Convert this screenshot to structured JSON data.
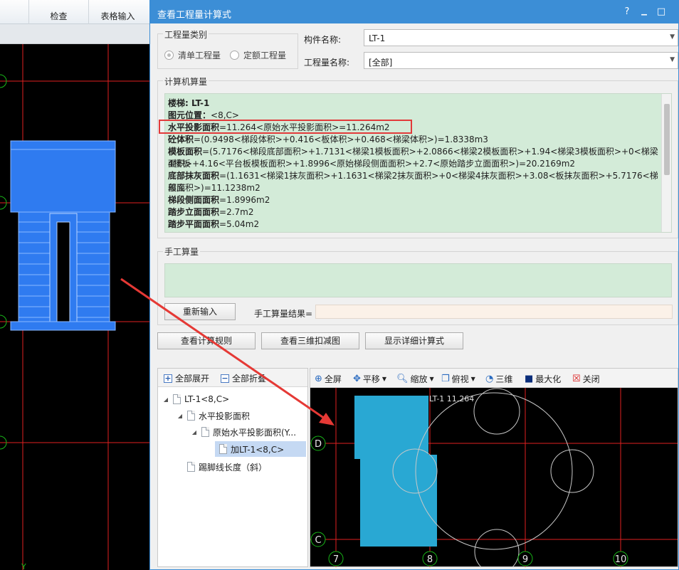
{
  "app": {
    "toolbar": [
      {
        "label": "检查"
      },
      {
        "label": "表格输入"
      }
    ],
    "axis_label_bottom": "Y"
  },
  "dialog": {
    "title": "查看工程量计算式",
    "controls": {
      "help": "?",
      "minimize": "▁",
      "maximize": "□"
    },
    "category": {
      "legend": "工程量类别",
      "options": [
        {
          "label": "清单工程量",
          "selected": true
        },
        {
          "label": "定额工程量",
          "selected": false
        }
      ]
    },
    "component": {
      "label": "构件名称:",
      "value": "LT-1"
    },
    "quantity_name": {
      "label": "工程量名称:",
      "value": "[全部]"
    },
    "computed": {
      "legend": "计算机算量",
      "lines": [
        {
          "name": "楼梯: LT-1",
          "rest": ""
        },
        {
          "name": "图元位置：",
          "rest": "<8,C>"
        },
        {
          "name": "水平投影面积",
          "rest": "=11.264<原始水平投影面积>=11.264m2"
        },
        {
          "name": "砼体积",
          "rest": "=(0.9498<梯段体积>+0.416<板体积>+0.468<梯梁体积>)=1.8338m3"
        },
        {
          "name": "模板面积",
          "rest": "=(5.7176<梯段底部面积>+1.7131<梯梁1模板面积>+2.0866<梯梁2模板面积>+1.94<梯梁3模板面积>+0<梯梁4模板"
        },
        {
          "name": "",
          "rest": "面积>+4.16<平台板模板面积>+1.8996<原始梯段侧面面积>+2.7<原始踏步立面面积>)=20.2169m2"
        },
        {
          "name": "底部抹灰面积",
          "rest": "=(1.1631<梯梁1抹灰面积>+1.1631<梯梁2抹灰面积>+0<梯梁4抹灰面积>+3.08<板抹灰面积>+5.7176<梯段底"
        },
        {
          "name": "",
          "rest": "部面积>)=11.1238m2"
        },
        {
          "name": "梯段侧面面积",
          "rest": "=1.8996m2"
        },
        {
          "name": "踏步立面面积",
          "rest": "=2.7m2"
        },
        {
          "name": "踏步平面面积",
          "rest": "=5.04m2"
        }
      ]
    },
    "manual": {
      "legend": "手工算量",
      "reenter_button": "重新输入",
      "result_label": "手工算量结果=",
      "result_value": ""
    },
    "actions": [
      {
        "label": "查看计算规则"
      },
      {
        "label": "查看三维扣减图"
      },
      {
        "label": "显示详细计算式"
      }
    ],
    "tree": {
      "toolbar": [
        {
          "label": "全部展开",
          "icon": "plus-square-icon"
        },
        {
          "label": "全部折叠",
          "icon": "minus-square-icon"
        }
      ],
      "nodes": [
        {
          "label": "LT-1<8,C>",
          "level": 0,
          "expanded": true
        },
        {
          "label": "水平投影面积",
          "level": 1,
          "expanded": true
        },
        {
          "label": "原始水平投影面积(Y...",
          "level": 2,
          "expanded": true
        },
        {
          "label": "加LT-1<8,C>",
          "level": 3,
          "selected": true
        },
        {
          "label": "踢脚线长度（斜）",
          "level": 1
        }
      ]
    },
    "view": {
      "toolbar": [
        {
          "label": "全屏",
          "icon": "fullscreen-icon"
        },
        {
          "label": "平移",
          "icon": "pan-icon",
          "dropdown": true
        },
        {
          "label": "缩放",
          "icon": "zoom-icon",
          "dropdown": true
        },
        {
          "label": "俯视",
          "icon": "top-view-icon",
          "dropdown": true
        },
        {
          "label": "三维",
          "icon": "3d-icon"
        },
        {
          "label": "最大化",
          "icon": "maximize-icon"
        },
        {
          "label": "关闭",
          "icon": "close-icon"
        }
      ],
      "element_label": "LT-1 11.264",
      "axis_rows": [
        "D",
        "C"
      ],
      "axis_cols": [
        "7",
        "8",
        "9",
        "10"
      ]
    }
  },
  "colors": {
    "title_bar": "#3c8ed6",
    "calc_bg": "#d3ebd8",
    "highlight": "#e23a3a",
    "stair_blue": "#2f7bf0",
    "element_fill": "#29a8d3",
    "grid_red": "#e02020",
    "axis_green": "#18b818"
  }
}
